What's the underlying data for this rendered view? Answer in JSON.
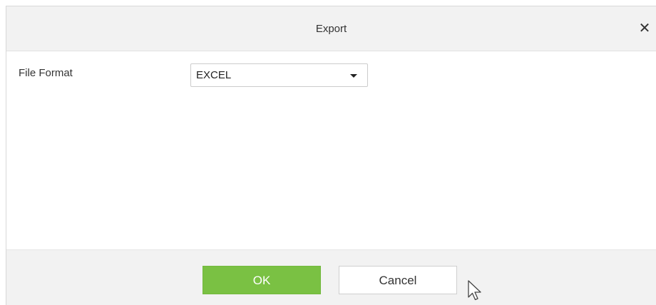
{
  "dialog": {
    "title": "Export",
    "close_icon": "close-icon"
  },
  "form": {
    "file_format_label": "File Format",
    "file_format_value": "EXCEL"
  },
  "footer": {
    "ok_label": "OK",
    "cancel_label": "Cancel"
  },
  "colors": {
    "ok_button": "#7ac143",
    "header_bg": "#f2f2f2"
  },
  "icons": {
    "dropdown": "chevron-down-icon",
    "cursor": "mouse-pointer-icon"
  }
}
